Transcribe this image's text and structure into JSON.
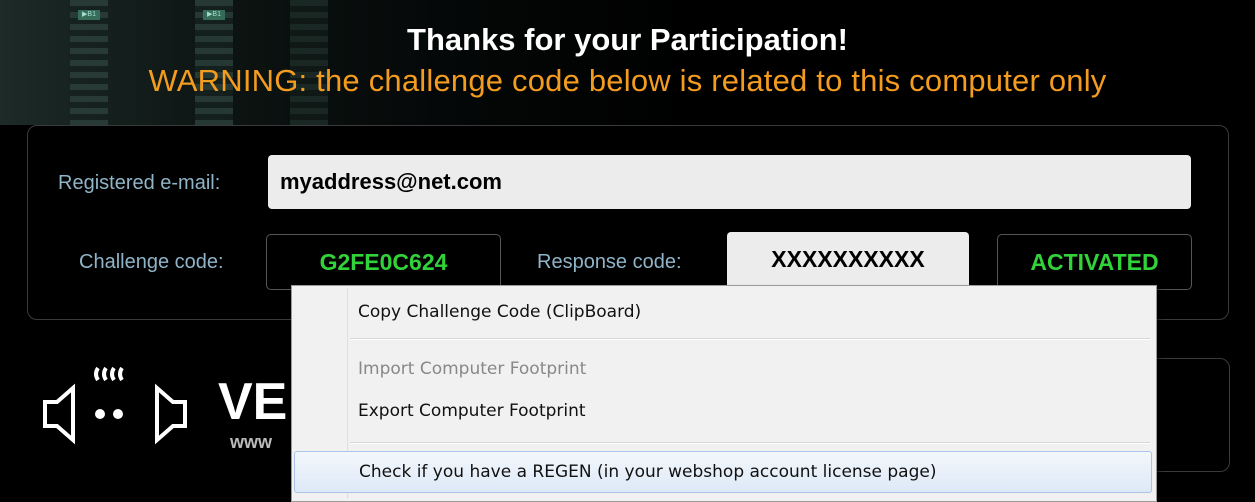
{
  "header": {
    "title": "Thanks for your Participation!",
    "warning": "WARNING: the challenge code below is related to this computer only"
  },
  "form": {
    "email_label": "Registered e-mail:",
    "email_value": "myaddress@net.com",
    "challenge_label": "Challenge code:",
    "challenge_value": "G2FE0C624",
    "response_label": "Response code:",
    "response_value": "XXXXXXXXXX",
    "status": "ACTIVATED"
  },
  "brand": {
    "name": "VE",
    "url": "www"
  },
  "context_menu": {
    "items": [
      {
        "label": "Copy Challenge Code (ClipBoard)",
        "enabled": true
      },
      {
        "label": "Import Computer Footprint",
        "enabled": false
      },
      {
        "label": "Export Computer Footprint",
        "enabled": true
      },
      {
        "label": "Check if you have a REGEN (in your webshop account license page)",
        "enabled": true,
        "highlighted": true
      }
    ]
  },
  "colors": {
    "accent_green": "#32d23a",
    "warning_orange": "#f39c1f",
    "label_blue": "#8fb4c8"
  }
}
